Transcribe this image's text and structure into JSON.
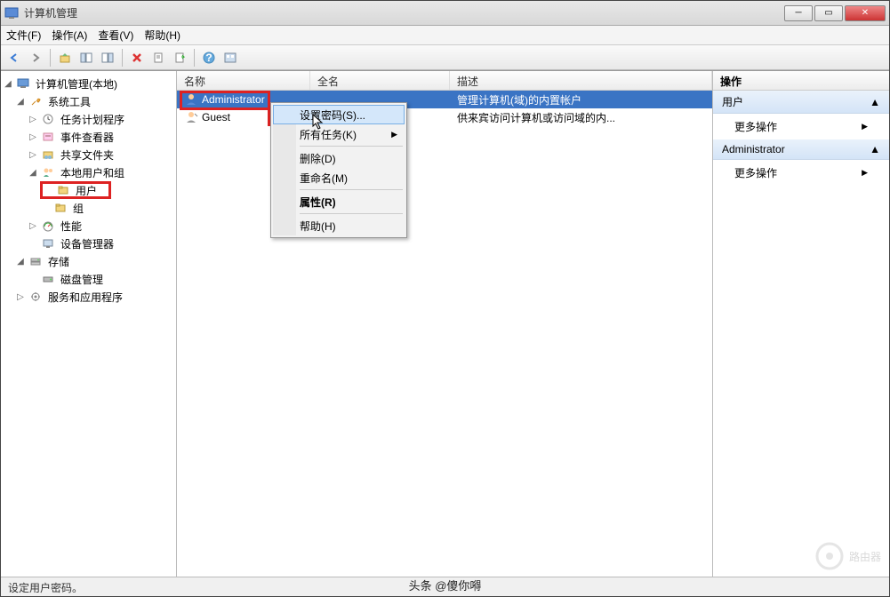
{
  "window": {
    "title": "计算机管理"
  },
  "menubar": {
    "file": "文件(F)",
    "action": "操作(A)",
    "view": "查看(V)",
    "help": "帮助(H)"
  },
  "tree": {
    "root": "计算机管理(本地)",
    "system_tools": "系统工具",
    "task_scheduler": "任务计划程序",
    "event_viewer": "事件查看器",
    "shared_folders": "共享文件夹",
    "local_users_groups": "本地用户和组",
    "users": "用户",
    "groups": "组",
    "performance": "性能",
    "device_manager": "设备管理器",
    "storage": "存储",
    "disk_management": "磁盘管理",
    "services_apps": "服务和应用程序"
  },
  "list": {
    "col_name": "名称",
    "col_fullname": "全名",
    "col_desc": "描述",
    "rows": [
      {
        "name": "Administrator",
        "fullname": "",
        "desc": "管理计算机(域)的内置帐户"
      },
      {
        "name": "Guest",
        "fullname": "",
        "desc": "供来宾访问计算机或访问域的内..."
      }
    ]
  },
  "context_menu": {
    "set_password": "设置密码(S)...",
    "all_tasks": "所有任务(K)",
    "delete": "删除(D)",
    "rename": "重命名(M)",
    "properties": "属性(R)",
    "help": "帮助(H)"
  },
  "actions_panel": {
    "header": "操作",
    "section1": "用户",
    "more1": "更多操作",
    "section2": "Administrator",
    "more2": "更多操作"
  },
  "statusbar": {
    "text": "设定用户密码。"
  },
  "watermark": {
    "text": "路由器"
  },
  "attribution": {
    "text": "头条 @傻你嘚"
  }
}
